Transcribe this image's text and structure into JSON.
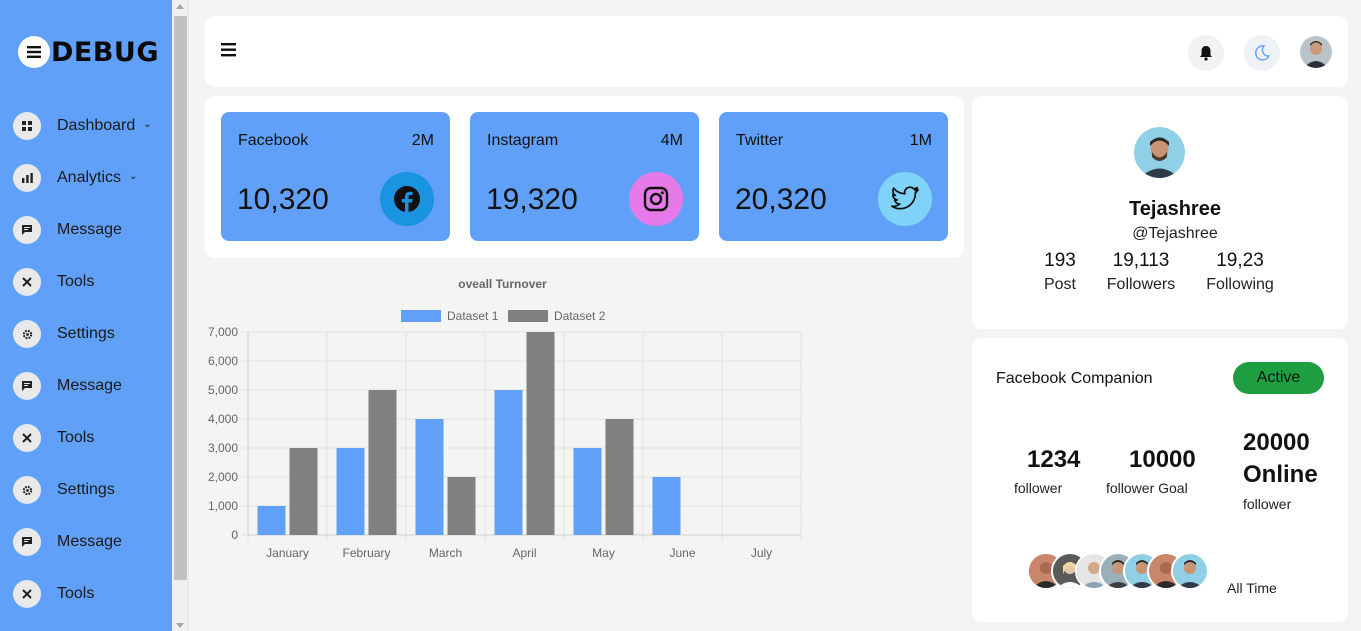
{
  "app": {
    "logo_text": "DEBUG"
  },
  "sidebar": {
    "items": [
      {
        "label": "Dashboard",
        "icon": "dashboard-icon",
        "caret": true
      },
      {
        "label": "Analytics",
        "icon": "analytics-icon",
        "caret": true
      },
      {
        "label": "Message",
        "icon": "message-icon",
        "caret": false
      },
      {
        "label": "Tools",
        "icon": "tools-icon",
        "caret": false
      },
      {
        "label": "Settings",
        "icon": "gear-icon",
        "caret": false
      },
      {
        "label": "Message",
        "icon": "message-icon",
        "caret": false
      },
      {
        "label": "Tools",
        "icon": "tools-icon",
        "caret": false
      },
      {
        "label": "Settings",
        "icon": "gear-icon",
        "caret": false
      },
      {
        "label": "Message",
        "icon": "message-icon",
        "caret": false
      },
      {
        "label": "Tools",
        "icon": "tools-icon",
        "caret": false
      }
    ]
  },
  "header": {
    "icons": [
      "menu-icon",
      "bell-icon",
      "moon-icon",
      "avatar"
    ]
  },
  "cards": [
    {
      "name": "Facebook",
      "total": "2M",
      "value": "10,320",
      "icon": "facebook-icon",
      "icon_bg": "#1a93e0"
    },
    {
      "name": "Instagram",
      "total": "4M",
      "value": "19,320",
      "icon": "instagram-icon",
      "icon_bg": "#e67ae8"
    },
    {
      "name": "Twitter",
      "total": "1M",
      "value": "20,320",
      "icon": "twitter-icon",
      "icon_bg": "#7fd2f8"
    }
  ],
  "chart_data": {
    "type": "bar",
    "title": "oveall Turnover",
    "categories": [
      "January",
      "February",
      "March",
      "April",
      "May",
      "June",
      "July"
    ],
    "series": [
      {
        "name": "Dataset 1",
        "color": "#60a0f8",
        "values": [
          1000,
          3000,
          4000,
          5000,
          3000,
          2000,
          null
        ]
      },
      {
        "name": "Dataset 2",
        "color": "#808080",
        "values": [
          3000,
          5000,
          2000,
          7000,
          4000,
          null,
          null
        ]
      }
    ],
    "yticks": [
      "0",
      "1,000",
      "2,000",
      "3,000",
      "4,000",
      "5,000",
      "6,000",
      "7,000"
    ],
    "ylim": [
      0,
      7000
    ],
    "grid": true,
    "legend": "top"
  },
  "profile": {
    "name": "Tejashree",
    "handle": "@Tejashree",
    "stats": [
      {
        "num": "193",
        "label": "Post"
      },
      {
        "num": "19,113",
        "label": "Followers"
      },
      {
        "num": "19,23",
        "label": "Following"
      }
    ]
  },
  "companion": {
    "title": "Facebook Companion",
    "status": "Active",
    "status_color": "#1e9e40",
    "stats": [
      {
        "num": "1234",
        "label": "follower"
      },
      {
        "num": "10000",
        "label": "follower Goal"
      },
      {
        "num": "20000 Online",
        "label": "follower"
      }
    ],
    "footer": "All Time"
  },
  "colors": {
    "sidebar": "#60a0f8",
    "card": "#60a0f8",
    "background": "#f4f4f3"
  }
}
